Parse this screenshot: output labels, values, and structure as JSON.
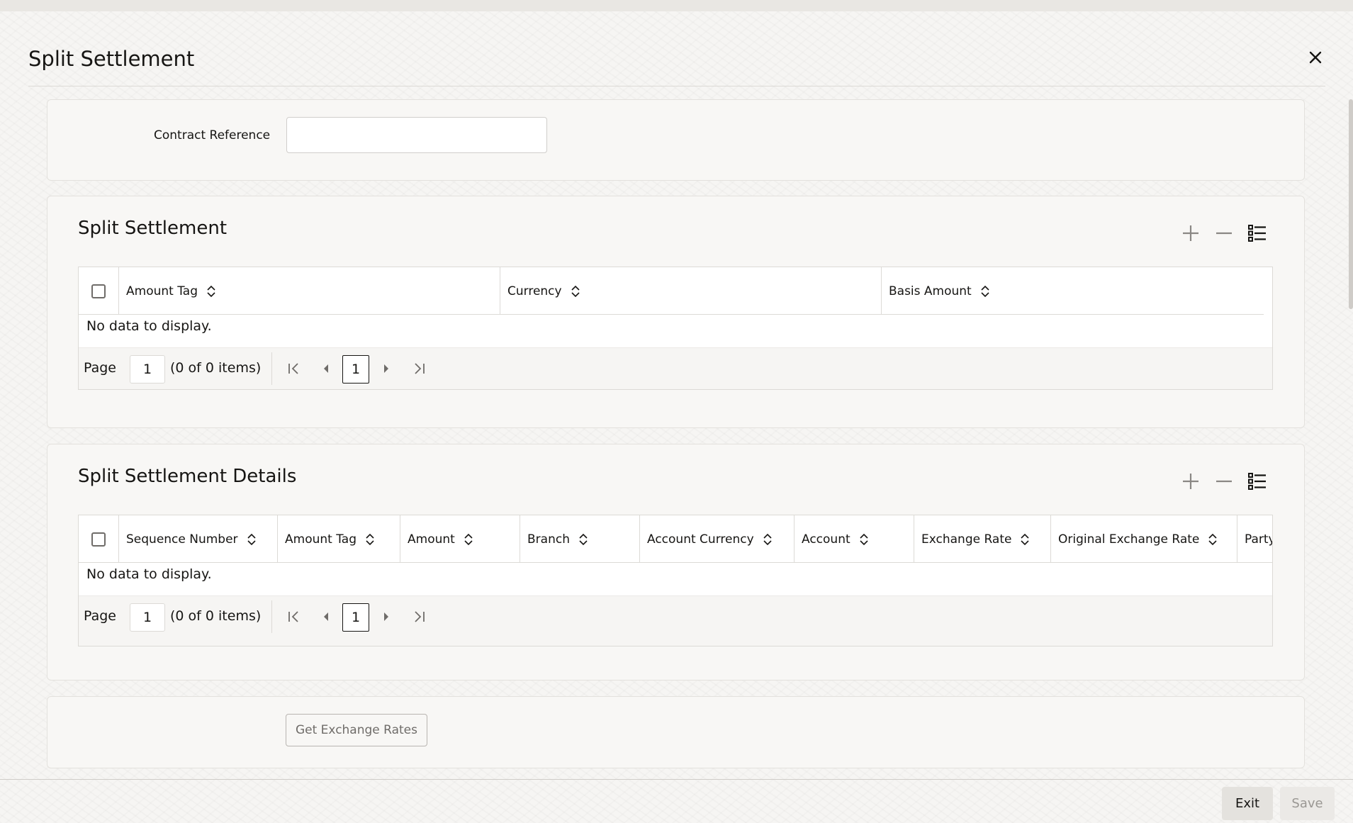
{
  "dialog": {
    "title": "Split Settlement"
  },
  "contract": {
    "label": "Contract Reference",
    "value": ""
  },
  "split_settlement": {
    "title": "Split Settlement",
    "columns": [
      "Amount Tag",
      "Currency",
      "Basis Amount"
    ],
    "empty_text": "No data to display.",
    "pager": {
      "page_label": "Page",
      "page_value": "1",
      "count_text": "(0 of 0 items)",
      "current_page": "1"
    }
  },
  "split_settlement_details": {
    "title": "Split Settlement Details",
    "columns": [
      "Sequence Number",
      "Amount Tag",
      "Amount",
      "Branch",
      "Account Currency",
      "Account",
      "Exchange Rate",
      "Original Exchange Rate",
      "Party"
    ],
    "empty_text": "No data to display.",
    "pager": {
      "page_label": "Page",
      "page_value": "1",
      "count_text": "(0 of 0 items)",
      "current_page": "1"
    }
  },
  "rates": {
    "button_label": "Get Exchange Rates"
  },
  "footer": {
    "exit_label": "Exit",
    "save_label": "Save"
  }
}
